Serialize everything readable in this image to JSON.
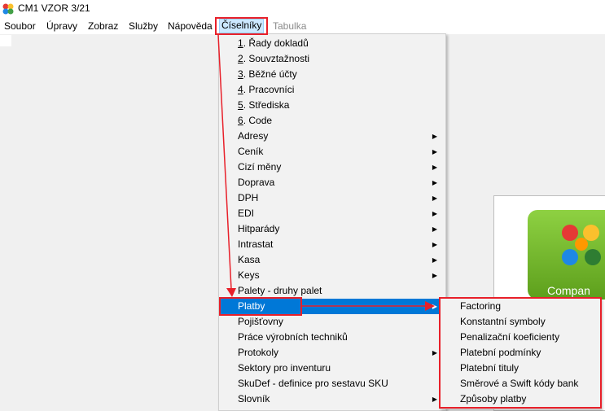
{
  "window": {
    "title": "CM1 VZOR 3/21"
  },
  "menubar": {
    "items": [
      "Soubor",
      "Úpravy",
      "Zobraz",
      "Služby",
      "Nápověda",
      "Číselníky",
      "Tabulka"
    ]
  },
  "dropdown": {
    "items": [
      {
        "prefix": "1",
        "rest": ". Řady dokladů"
      },
      {
        "prefix": "2",
        "rest": ". Souvztažnosti"
      },
      {
        "prefix": "3",
        "rest": ". Běžné účty"
      },
      {
        "prefix": "4",
        "rest": ". Pracovníci"
      },
      {
        "prefix": "5",
        "rest": ". Střediska"
      },
      {
        "prefix": "6",
        "rest": ". Code"
      },
      {
        "label": "Adresy"
      },
      {
        "label": "Ceník"
      },
      {
        "label": "Cizí měny"
      },
      {
        "label": "Doprava"
      },
      {
        "label": "DPH"
      },
      {
        "label": "EDI"
      },
      {
        "label": "Hitparády"
      },
      {
        "label": "Intrastat"
      },
      {
        "label": "Kasa"
      },
      {
        "label": "Keys"
      },
      {
        "label": "Palety - druhy palet"
      },
      {
        "label": "Platby"
      },
      {
        "label": "Pojišťovny"
      },
      {
        "label": "Práce výrobních techniků"
      },
      {
        "label": "Protokoly"
      },
      {
        "label": "Sektory pro inventuru"
      },
      {
        "label": "SkuDef - definice pro sestavu SKU"
      },
      {
        "label": "Slovník"
      }
    ]
  },
  "submenu": {
    "items": [
      "Factoring",
      "Konstantní symboly",
      "Penalizační koeficienty",
      "Platební podmínky",
      "Platební tituly",
      "Směrové a Swift kódy bank",
      "Způsoby platby"
    ]
  },
  "logo": {
    "text": "Compan"
  }
}
